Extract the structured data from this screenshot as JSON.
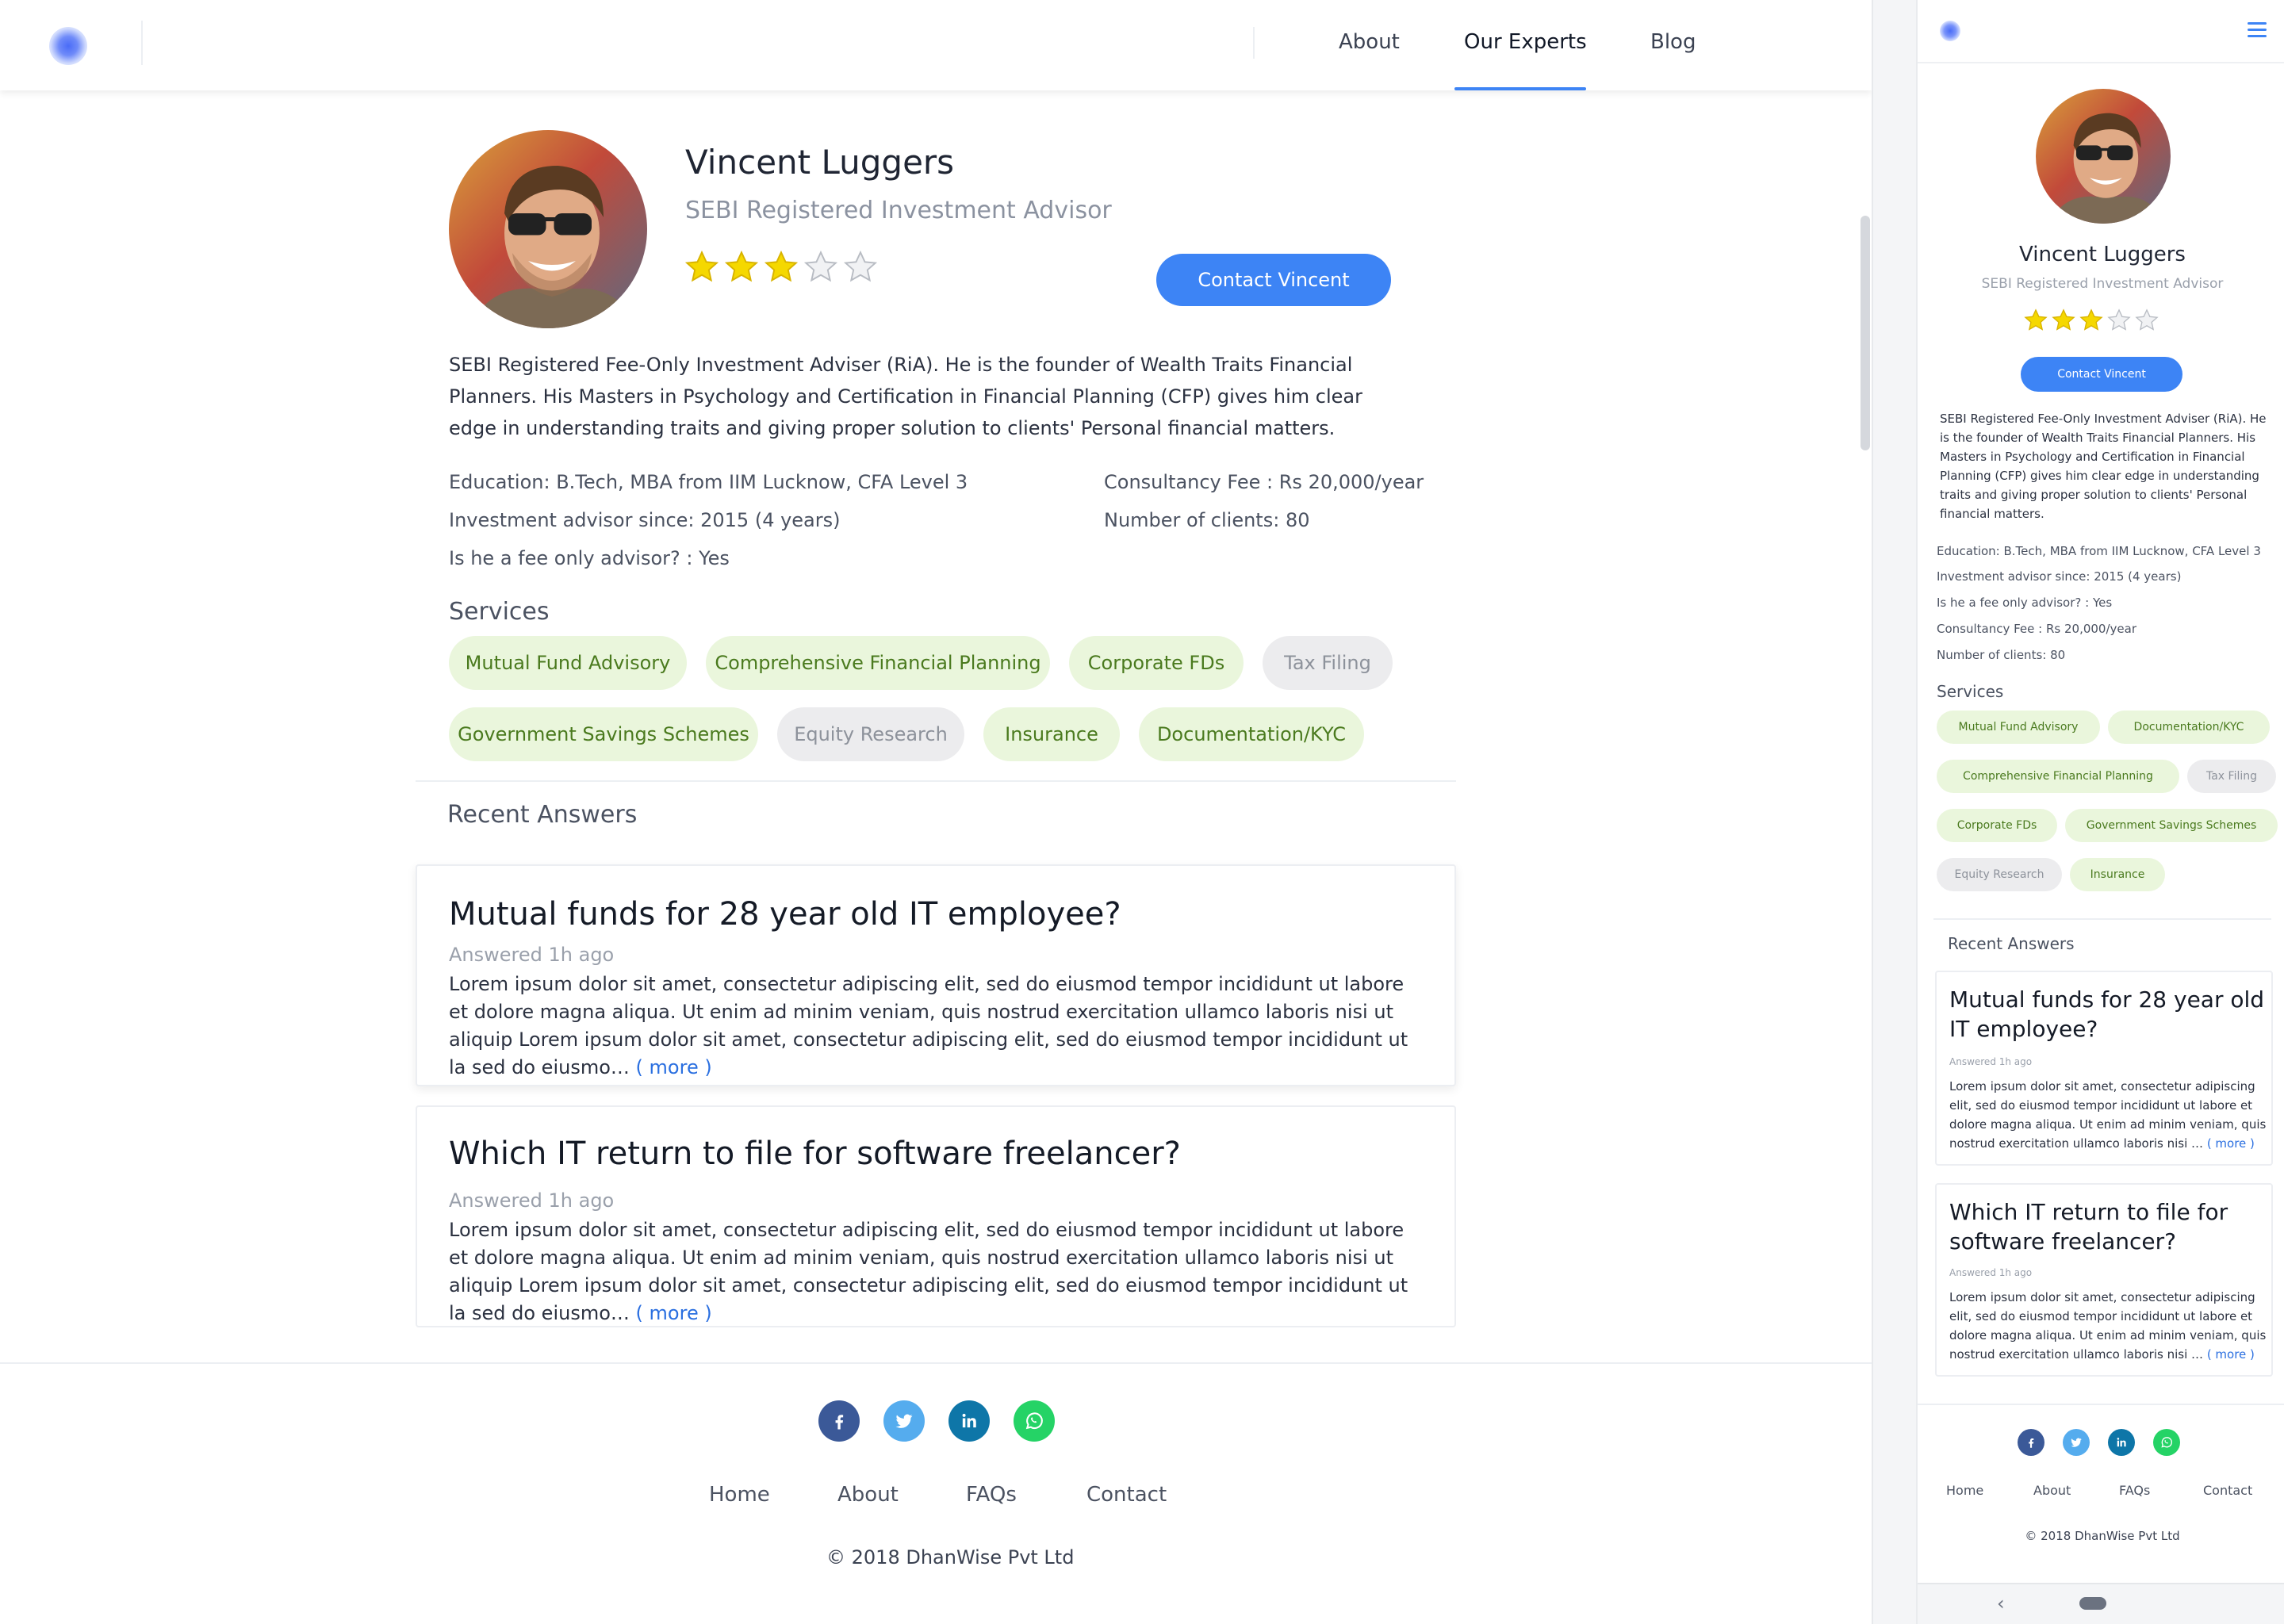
{
  "nav": {
    "about": "About",
    "experts": "Our Experts",
    "blog": "Blog"
  },
  "expert": {
    "name": "Vincent Luggers",
    "title": "SEBI Registered Investment Advisor",
    "rating": 3,
    "rating_max": 5,
    "contact_label": "Contact Vincent",
    "bio": "SEBI Registered Fee-Only Investment Adviser (RiA). He is the founder of Wealth Traits Financial Planners. His Masters in Psychology and Certification in Financial Planning (CFP) gives him clear edge in understanding traits and giving proper solution to clients' Personal financial matters.",
    "education": "Education: B.Tech, MBA from IIM Lucknow, CFA Level 3",
    "advisor_since": "Investment advisor since: 2015 (4 years)",
    "fee_only": "Is he a fee only advisor? : Yes",
    "fee": "Consultancy Fee : Rs 20,000/year",
    "clients": "Number of clients: 80"
  },
  "services": {
    "title": "Services",
    "items": [
      {
        "label": "Mutual Fund Advisory",
        "active": true
      },
      {
        "label": "Comprehensive Financial Planning",
        "active": true
      },
      {
        "label": "Corporate FDs",
        "active": true
      },
      {
        "label": "Tax Filing",
        "active": false
      },
      {
        "label": "Government Savings Schemes",
        "active": true
      },
      {
        "label": "Equity Research",
        "active": false
      },
      {
        "label": "Insurance",
        "active": true
      },
      {
        "label": "Documentation/KYC",
        "active": true
      }
    ]
  },
  "recent": {
    "title": "Recent Answers",
    "answers": [
      {
        "question": "Mutual funds for 28 year old IT employee?",
        "meta": "Answered 1h ago",
        "body": "Lorem ipsum dolor sit amet, consectetur adipiscing elit, sed do eiusmod tempor incididunt ut labore et dolore magna aliqua. Ut enim ad minim veniam, quis nostrud exercitation ullamco laboris nisi ut aliquip Lorem ipsum dolor sit amet, consectetur adipiscing elit, sed do eiusmod tempor incididunt ut la sed do eiusmo…",
        "mobile_body": "Lorem ipsum dolor sit amet, consectetur adipiscing elit, sed do eiusmod tempor incididunt ut labore et dolore magna aliqua. Ut enim ad minim veniam, quis nostrud exercitation ullamco laboris nisi …",
        "more": "( more )"
      },
      {
        "question": "Which IT return to file for software freelancer?",
        "meta": "Answered 1h ago",
        "body": "Lorem ipsum dolor sit amet, consectetur adipiscing elit, sed do eiusmod tempor incididunt ut labore et dolore magna aliqua. Ut enim ad minim veniam, quis nostrud exercitation ullamco laboris nisi ut aliquip Lorem ipsum dolor sit amet, consectetur adipiscing elit, sed do eiusmod tempor incididunt ut la sed do eiusmo…",
        "mobile_body": "Lorem ipsum dolor sit amet, consectetur adipiscing elit, sed do eiusmod tempor incididunt ut labore et dolore magna aliqua. Ut enim ad minim veniam, quis nostrud exercitation ullamco laboris nisi …",
        "more": "( more )"
      }
    ]
  },
  "footer": {
    "social": [
      {
        "name": "facebook-icon",
        "color": "#3b5998"
      },
      {
        "name": "twitter-icon",
        "color": "#55acee"
      },
      {
        "name": "linkedin-icon",
        "color": "#0e76a8"
      },
      {
        "name": "whatsapp-icon",
        "color": "#25d366"
      }
    ],
    "links": {
      "home": "Home",
      "about": "About",
      "faqs": "FAQs",
      "contact": "Contact"
    },
    "copyright": "© 2018 DhanWise Pvt Ltd"
  },
  "mobile_nav": {
    "back": "‹"
  },
  "colors": {
    "accent": "#3d84f5",
    "chip_active_bg": "#eaf6dc",
    "chip_active_text": "#4a7a1e",
    "chip_inactive_bg": "#ececee",
    "star": "#f5d800"
  }
}
